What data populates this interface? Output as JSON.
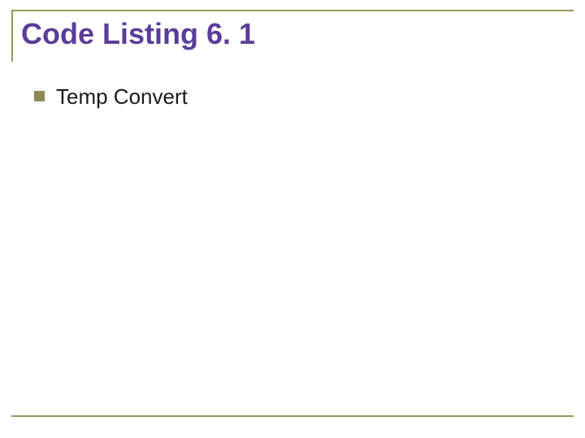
{
  "slide": {
    "title": "Code Listing 6. 1",
    "bullets": [
      {
        "text": "Temp Convert"
      }
    ]
  },
  "colors": {
    "title": "#5a3d99",
    "accent": "#99995a",
    "bullet_box": "#8a8a56",
    "body_text": "#1a1a1a"
  }
}
